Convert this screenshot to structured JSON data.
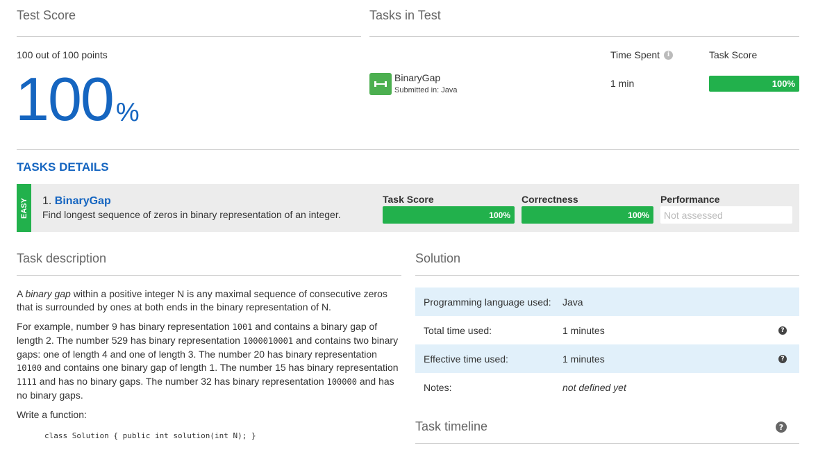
{
  "test_score": {
    "title": "Test Score",
    "points_text": "100 out of 100 points",
    "big_value": "100",
    "percent_sign": "%"
  },
  "tasks_in_test": {
    "title": "Tasks in Test",
    "col_time_spent": "Time Spent",
    "col_task_score": "Task Score",
    "task_name": "BinaryGap",
    "submitted_in": "Submitted in: Java",
    "time_spent": "1 min",
    "task_score_label": "100%",
    "task_score_value": 100
  },
  "tasks_details": {
    "title": "TASKS DETAILS",
    "difficulty": "EASY",
    "task_number": "1.",
    "task_name": "BinaryGap",
    "task_summary": "Find longest sequence of zeros in binary representation of an integer.",
    "task_score_label": "Task Score",
    "task_score_value_text": "100%",
    "task_score_value": 100,
    "correctness_label": "Correctness",
    "correctness_value_text": "100%",
    "correctness_value": 100,
    "performance_label": "Performance",
    "performance_value_text": "Not assessed"
  },
  "task_description": {
    "title": "Task description",
    "p1_a": "A ",
    "p1_em": "binary gap",
    "p1_b": " within a positive integer N is any maximal sequence of consecutive zeros that is surrounded by ones at both ends in the binary representation of N.",
    "p2_a": "For example, number 9 has binary representation ",
    "p2_c1": "1001",
    "p2_b": " and contains a binary gap of length 2. The number 529 has binary representation ",
    "p2_c2": "1000010001",
    "p2_c": " and contains two binary gaps: one of length 4 and one of length 3. The number 20 has binary representation ",
    "p2_c3": "10100",
    "p2_d": " and contains one binary gap of length 1. The number 15 has binary representation ",
    "p2_c4": "1111",
    "p2_e": " and has no binary gaps. The number 32 has binary representation ",
    "p2_c5": "100000",
    "p2_f": " and has no binary gaps.",
    "p3": "Write a function:",
    "code": "class Solution { public int solution(int N); }"
  },
  "solution": {
    "title": "Solution",
    "rows": [
      {
        "key": "Programming language used:",
        "value": "Java"
      },
      {
        "key": "Total time used:",
        "value": "1 minutes"
      },
      {
        "key": "Effective time used:",
        "value": "1 minutes"
      },
      {
        "key": "Notes:",
        "value": "not defined yet"
      }
    ],
    "timeline_title": "Task timeline"
  },
  "icons": {
    "task_icon": "dumbbell-icon",
    "info": "info-icon",
    "help": "help-icon"
  },
  "colors": {
    "brand_blue": "#1565c0",
    "success_green": "#22b14c",
    "row_highlight": "#e1f0fa"
  }
}
